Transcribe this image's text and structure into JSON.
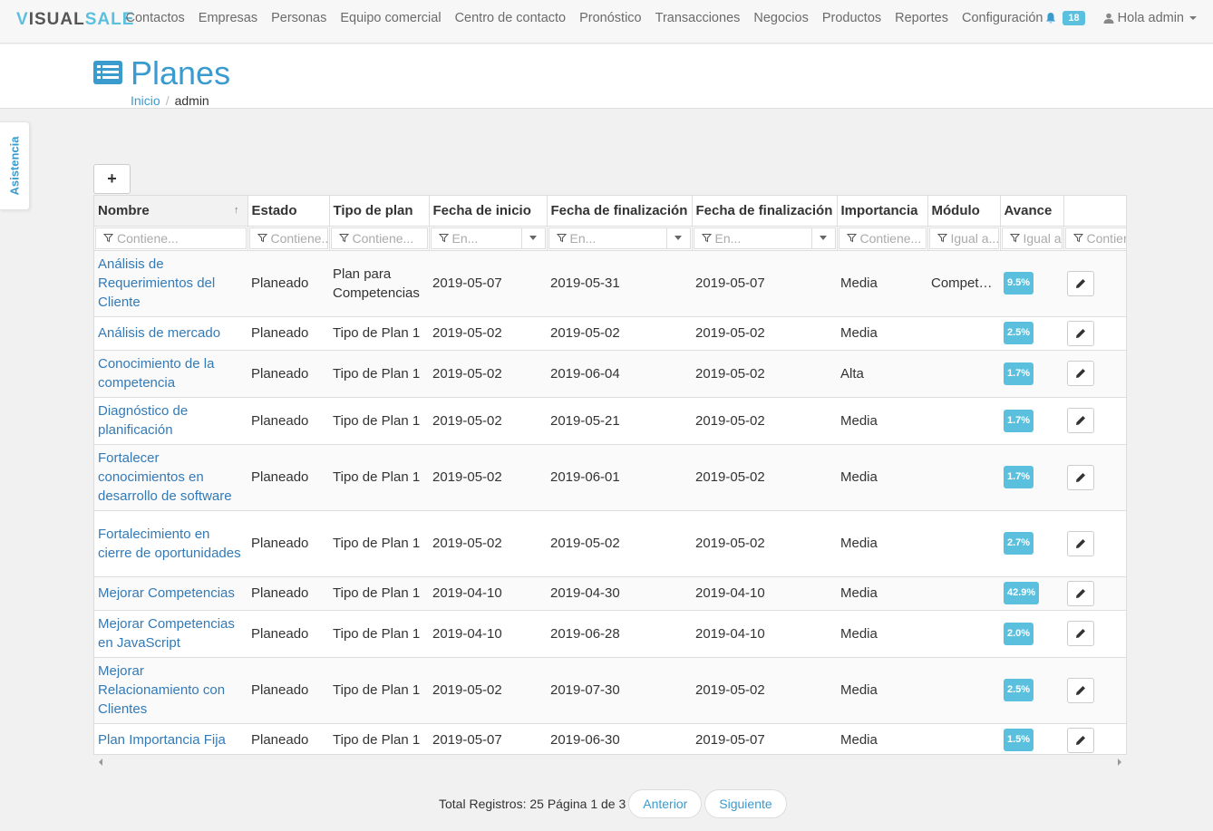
{
  "brand": {
    "part1": "V",
    "part2": "ISUAL",
    "part3": "SALE"
  },
  "nav": {
    "links": [
      "Contactos",
      "Empresas",
      "Personas",
      "Equipo comercial",
      "Centro de contacto",
      "Pronóstico",
      "Transacciones",
      "Negocios",
      "Productos",
      "Reportes",
      "Configuración"
    ],
    "notifications": "18",
    "user_label": "Hola admin"
  },
  "header": {
    "title": "Planes",
    "breadcrumb_home": "Inicio",
    "breadcrumb_sep": "/",
    "breadcrumb_current": "admin"
  },
  "sidetab": {
    "label": "Asistencia"
  },
  "toolbar": {
    "add_label": "+"
  },
  "table": {
    "columns": [
      "Nombre",
      "Estado",
      "Tipo de plan",
      "Fecha de inicio",
      "Fecha de finalización",
      "Fecha de finalización",
      "Importancia",
      "Módulo",
      "Avance",
      ""
    ],
    "sort_indicator": "↑",
    "filters": [
      "Contiene...",
      "Contiene...",
      "Contiene...",
      "En...",
      "En...",
      "En...",
      "Contiene...",
      "Igual a...",
      "Igual a...",
      "Contiene..."
    ],
    "rows": [
      {
        "nombre": "Análisis de Requerimientos del Cliente",
        "estado": "Planeado",
        "tipo": "Plan para Competencias",
        "inicio": "2019-05-07",
        "fin": "2019-05-31",
        "fin2": "2019-05-07",
        "importancia": "Media",
        "modulo": "Competencias",
        "avance": "9.5%"
      },
      {
        "nombre": "Análisis de mercado",
        "estado": "Planeado",
        "tipo": "Tipo de Plan 1",
        "inicio": "2019-05-02",
        "fin": "2019-05-02",
        "fin2": "2019-05-02",
        "importancia": "Media",
        "modulo": "",
        "avance": "2.5%"
      },
      {
        "nombre": "Conocimiento de la competencia",
        "estado": "Planeado",
        "tipo": "Tipo de Plan 1",
        "inicio": "2019-05-02",
        "fin": "2019-06-04",
        "fin2": "2019-05-02",
        "importancia": "Alta",
        "modulo": "",
        "avance": "1.7%"
      },
      {
        "nombre": "Diagnóstico de planificación",
        "estado": "Planeado",
        "tipo": "Tipo de Plan 1",
        "inicio": "2019-05-02",
        "fin": "2019-05-21",
        "fin2": "2019-05-02",
        "importancia": "Media",
        "modulo": "",
        "avance": "1.7%"
      },
      {
        "nombre": "Fortalecer conocimientos en desarrollo de software",
        "estado": "Planeado",
        "tipo": "Tipo de Plan 1",
        "inicio": "2019-05-02",
        "fin": "2019-06-01",
        "fin2": "2019-05-02",
        "importancia": "Media",
        "modulo": "",
        "avance": "1.7%"
      },
      {
        "nombre": "Fortalecimiento en cierre de oportunidades",
        "estado": "Planeado",
        "tipo": "Tipo de Plan 1",
        "inicio": "2019-05-02",
        "fin": "2019-05-02",
        "fin2": "2019-05-02",
        "importancia": "Media",
        "modulo": "",
        "avance": "2.7%"
      },
      {
        "nombre": "Mejorar Competencias",
        "estado": "Planeado",
        "tipo": "Tipo de Plan 1",
        "inicio": "2019-04-10",
        "fin": "2019-04-30",
        "fin2": "2019-04-10",
        "importancia": "Media",
        "modulo": "",
        "avance": "42.9%"
      },
      {
        "nombre": "Mejorar Competencias en JavaScript",
        "estado": "Planeado",
        "tipo": "Tipo de Plan 1",
        "inicio": "2019-04-10",
        "fin": "2019-06-28",
        "fin2": "2019-04-10",
        "importancia": "Media",
        "modulo": "",
        "avance": "2.0%"
      },
      {
        "nombre": "Mejorar Relacionamiento con Clientes",
        "estado": "Planeado",
        "tipo": "Tipo de Plan 1",
        "inicio": "2019-05-02",
        "fin": "2019-07-30",
        "fin2": "2019-05-02",
        "importancia": "Media",
        "modulo": "",
        "avance": "2.5%"
      },
      {
        "nombre": "Plan Importancia Fija",
        "estado": "Planeado",
        "tipo": "Tipo de Plan 1",
        "inicio": "2019-05-07",
        "fin": "2019-06-30",
        "fin2": "2019-05-07",
        "importancia": "Media",
        "modulo": "",
        "avance": "1.5%"
      }
    ]
  },
  "pager": {
    "summary": "Total Registros: 25 Página 1 de 3",
    "prev_label": "Anterior",
    "next_label": "Siguiente"
  },
  "colors": {
    "accent": "#5bc0de",
    "link": "#337ab7"
  },
  "icons": {
    "bell": "bell-icon",
    "user": "user-icon",
    "title": "list-icon",
    "filter": "filter-icon",
    "edit": "pencil-icon"
  }
}
